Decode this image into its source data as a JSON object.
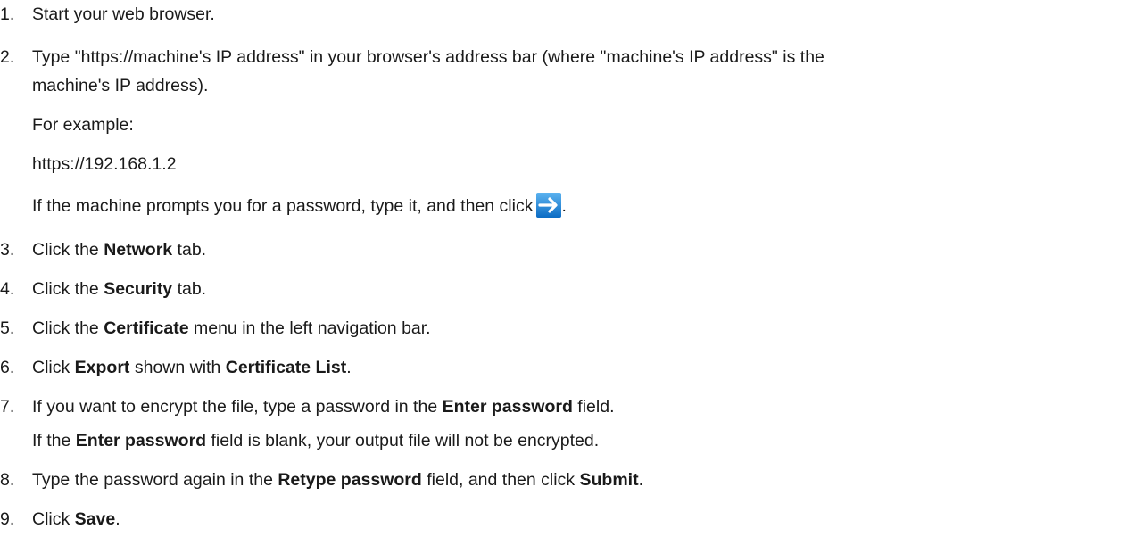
{
  "steps": [
    {
      "num": "1.",
      "parts": [
        {
          "t": "Start your web browser."
        }
      ]
    },
    {
      "num": "2.",
      "parts": [
        {
          "t": "Type \"https://machine's IP address\" in your browser's address bar (where \"machine's IP address\" is the"
        }
      ],
      "cont": "machine's IP address).",
      "example_label": "For example:",
      "example_url": "https://192.168.1.2",
      "password_note": "If the machine prompts you for a password, type it, and then click",
      "password_note_end": "."
    },
    {
      "num": "3.",
      "a": "Click the ",
      "b": "Network",
      "c": " tab."
    },
    {
      "num": "4.",
      "a": "Click the ",
      "b": "Security",
      "c": " tab."
    },
    {
      "num": "5.",
      "a": "Click the ",
      "b": "Certificate",
      "c": " menu in the left navigation bar."
    },
    {
      "num": "6.",
      "a": "Click ",
      "b": "Export",
      "c": " shown with ",
      "d": "Certificate List",
      "e": "."
    },
    {
      "num": "7.",
      "a": "If you want to encrypt the file, type a password in the ",
      "b": "Enter password",
      "c": " field.",
      "note_a": "If the ",
      "note_b": "Enter password",
      "note_c": " field is blank, your output file will not be encrypted."
    },
    {
      "num": "8.",
      "a": "Type the password again in the ",
      "b": "Retype password",
      "c": " field, and then click ",
      "d": "Submit",
      "e": "."
    },
    {
      "num": "9.",
      "a": "Click ",
      "b": "Save",
      "c": "."
    }
  ],
  "icons": {
    "go_arrow": "right-arrow-icon",
    "go_arrow_color": "#1e88d8"
  }
}
